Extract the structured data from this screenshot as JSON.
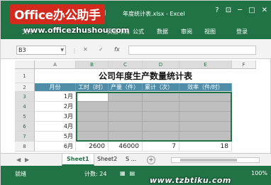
{
  "titlebar": {
    "doc_title": "年度统计表.xlsx - Excel",
    "win_help": "?",
    "win_restore": "⊡",
    "win_min": "─",
    "win_max": "□",
    "win_close": "✕"
  },
  "watermark": {
    "logo_text": "Office办公助手",
    "url_top": "www.officezhushou.com",
    "url_bottom": "www.tzbtiku.com"
  },
  "ribbon": {
    "tabs": [
      {
        "label": "文件"
      },
      {
        "label": "页面布局"
      },
      {
        "label": "公式"
      },
      {
        "label": "数据"
      },
      {
        "label": "审阅"
      },
      {
        "label": "视图"
      }
    ],
    "login": "登录"
  },
  "formula_bar": {
    "name_box": "B3",
    "cancel": "✕",
    "enter": "✓",
    "fx": "fx",
    "content": ""
  },
  "grid": {
    "columns": [
      "A",
      "B",
      "C",
      "D",
      "E",
      "F"
    ],
    "rows": [
      "1",
      "2",
      "3",
      "4",
      "5",
      "6",
      "7",
      "8"
    ],
    "title": "公司年度生产数量统计表",
    "headers": [
      "月份",
      "工时（时）",
      "产量（件）",
      "累计（次）",
      "效率（件/时）"
    ],
    "months": [
      "1月",
      "2月",
      "3月",
      "4月",
      "5月",
      "6月"
    ],
    "row8": {
      "hours": "2600",
      "output": "46000",
      "count": "7",
      "efficiency": "18"
    }
  },
  "sheets": {
    "tabs": [
      "Sheet1",
      "Sheet2",
      "S ..."
    ],
    "active": "Sheet1",
    "add": "+"
  },
  "status": {
    "ready": "就绪",
    "count_label": "计数: 24",
    "zoom": "100%"
  },
  "colors": {
    "excel_green": "#217346",
    "header_fill": "#4f8ca8",
    "selection_fill": "#bfbfbf",
    "logo_red": "#d42a1e"
  }
}
